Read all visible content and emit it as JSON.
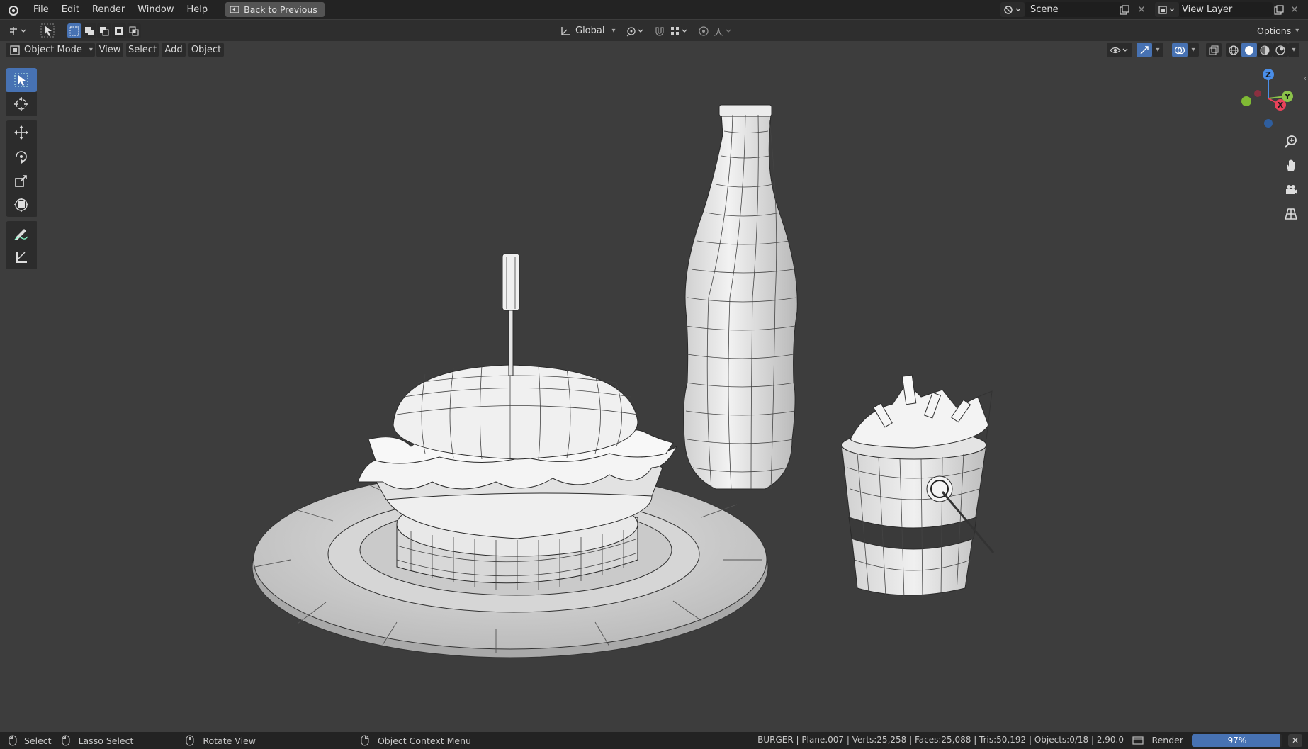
{
  "menu": {
    "items": [
      "File",
      "Edit",
      "Render",
      "Window",
      "Help"
    ],
    "back_label": "Back to Previous"
  },
  "scene": {
    "name": "Scene"
  },
  "view_layer": {
    "name": "View Layer"
  },
  "header": {
    "transform_orientation": "Global",
    "options_label": "Options"
  },
  "viewport_header": {
    "mode": "Object Mode",
    "menus": [
      "View",
      "Select",
      "Add",
      "Object"
    ]
  },
  "tools": [
    "select-box",
    "cursor",
    "move",
    "rotate",
    "scale",
    "transform",
    "annotate",
    "measure"
  ],
  "gizmo": {
    "z": "Z",
    "x": "X",
    "y": "Y"
  },
  "status": {
    "select": "Select",
    "lasso": "Lasso Select",
    "rotate": "Rotate View",
    "context_menu": "Object Context Menu",
    "stats": "BURGER | Plane.007 | Verts:25,258 | Faces:25,088 | Tris:50,192 | Objects:0/18 | 2.90.0",
    "render_label": "Render",
    "progress_text": "97%",
    "progress": 0.97
  },
  "colors": {
    "accent": "#4772b3",
    "axis_x": "#e8425a",
    "axis_y": "#8bc34a",
    "axis_z": "#4a8ee8"
  }
}
